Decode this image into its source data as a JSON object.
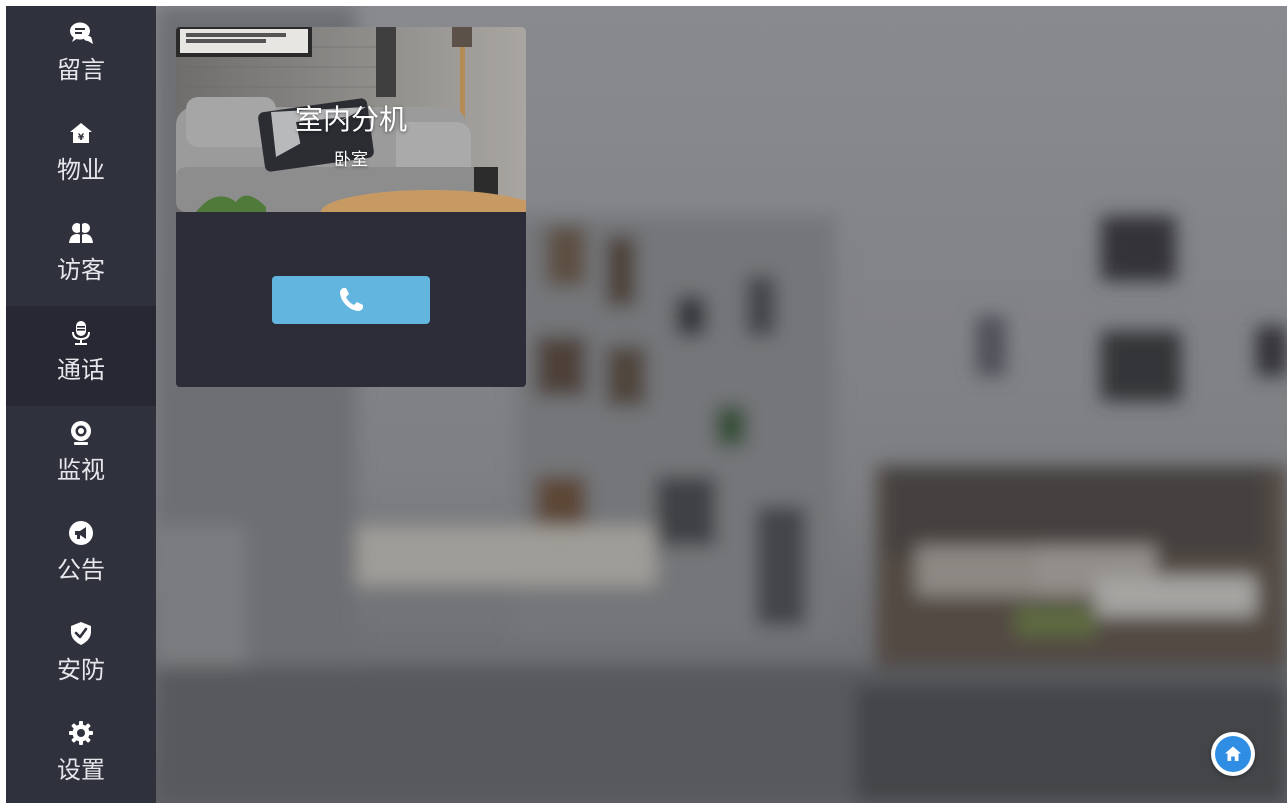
{
  "sidebar": {
    "items": [
      {
        "label": "留言",
        "icon": "chat-bubbles-icon"
      },
      {
        "label": "物业",
        "icon": "house-yen-icon"
      },
      {
        "label": "访客",
        "icon": "visitors-icon"
      },
      {
        "label": "通话",
        "icon": "microphone-icon",
        "active": true
      },
      {
        "label": "监视",
        "icon": "webcam-icon"
      },
      {
        "label": "公告",
        "icon": "megaphone-icon"
      },
      {
        "label": "安防",
        "icon": "shield-check-icon"
      },
      {
        "label": "设置",
        "icon": "gear-icon"
      }
    ]
  },
  "card": {
    "title": "室内分机",
    "subtitle": "卧室",
    "call_icon": "phone-icon",
    "button_color": "#62b5de"
  },
  "home_button": {
    "icon": "home-icon",
    "color": "#2f8ee3"
  },
  "colors": {
    "sidebar_bg": "#2f313d",
    "sidebar_active_bg": "#272833",
    "card_bg": "#2c2d38"
  }
}
